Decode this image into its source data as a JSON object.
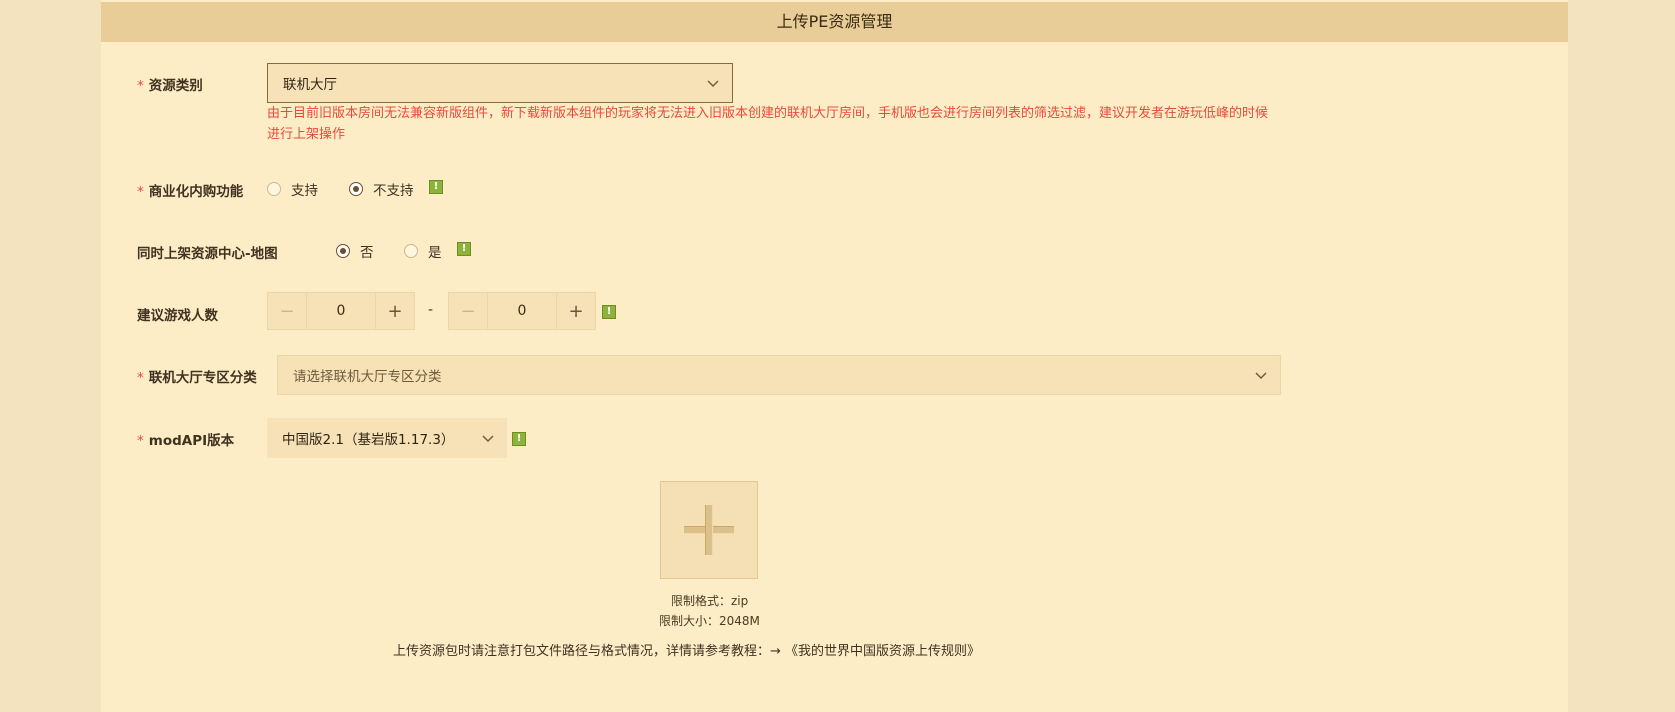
{
  "header": {
    "title": "上传PE资源管理"
  },
  "required_mark": "*",
  "fields": {
    "resource_type": {
      "label": "资源类别",
      "value": "联机大厅",
      "warning": "由于目前旧版本房间无法兼容新版组件，新下载新版本组件的玩家将无法进入旧版本创建的联机大厅房间，手机版也会进行房间列表的筛选过滤，建议开发者在游玩低峰的时候进行上架操作"
    },
    "iap": {
      "label": "商业化内购功能",
      "options": [
        "支持",
        "不支持"
      ],
      "selected": "不支持"
    },
    "map_center": {
      "label": "同时上架资源中心-地图",
      "options": [
        "否",
        "是"
      ],
      "selected": "否"
    },
    "players": {
      "label": "建议游戏人数",
      "min": "0",
      "max": "0",
      "separator": "-"
    },
    "lobby_category": {
      "label": "联机大厅专区分类",
      "placeholder": "请选择联机大厅专区分类"
    },
    "mod_api": {
      "label": "modAPI版本",
      "value": "中国版2.1（基岩版1.17.3）"
    }
  },
  "upload": {
    "format": "限制格式：zip",
    "size": "限制大小：2048M",
    "tip_prefix": "上传资源包时请注意打包文件路径与格式情况，详情请参考教程：→",
    "tip_link": "《我的世界中国版资源上传规则》"
  },
  "icons": {
    "info": "!",
    "minus": "−",
    "plus": "+"
  },
  "colors": {
    "accent_red": "#e64a3c",
    "header_bg": "#e8cd99",
    "panel_bg": "#fdedc7",
    "info_green": "#8fb33a"
  }
}
